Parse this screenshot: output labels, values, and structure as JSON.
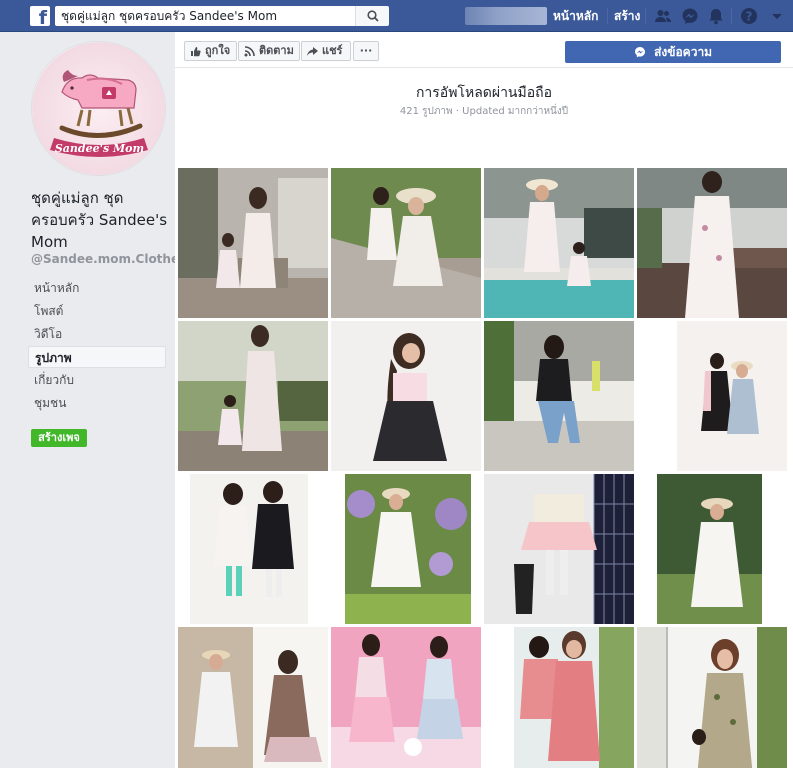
{
  "topbar": {
    "search_value": "ชุดคู่แม่ลูก ชุดครอบครัว Sandee's Mom",
    "home_label": "หน้าหลัก",
    "create_label": "สร้าง",
    "icons": [
      "facebook-logo-icon",
      "search-icon",
      "friends-icon",
      "messenger-icon",
      "bell-icon",
      "help-icon",
      "caret-down-icon"
    ]
  },
  "sidebar": {
    "logo_text": "Sandee's Mom",
    "page_name": "ชุดคู่แม่ลูก ชุดครอบครัว Sandee's Mom",
    "handle": "@Sandee.mom.Clothes",
    "nav": [
      {
        "label": "หน้าหลัก",
        "active": false
      },
      {
        "label": "โพสต์",
        "active": false
      },
      {
        "label": "วิดีโอ",
        "active": false
      },
      {
        "label": "รูปภาพ",
        "active": true
      },
      {
        "label": "เกี่ยวกับ",
        "active": false
      },
      {
        "label": "ชุมชน",
        "active": false
      }
    ],
    "create_page_label": "สร้างเพจ"
  },
  "actions": {
    "like_label": "ถูกใจ",
    "follow_label": "ติดตาม",
    "share_label": "แชร์",
    "more_label": "···",
    "message_label": "ส่งข้อความ"
  },
  "album": {
    "title": "การอัพโหลดผ่านมือถือ",
    "meta": "421 รูปภาพ · Updated มากกว่าหนึ่งปี"
  },
  "colors": {
    "brand": "#3b5998",
    "button_blue": "#4267b2",
    "green": "#42b72a"
  }
}
